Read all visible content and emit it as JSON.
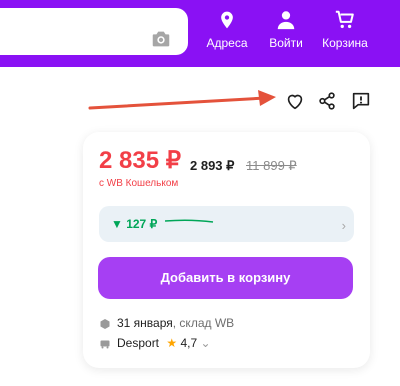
{
  "header": {
    "bg_color": "#8a11f4",
    "items": [
      {
        "label": "Адреса",
        "icon": "location-pin-icon"
      },
      {
        "label": "Войти",
        "icon": "user-icon"
      },
      {
        "label": "Корзина",
        "icon": "cart-icon"
      }
    ],
    "search_icon": "camera-icon"
  },
  "actions": {
    "icons": [
      "heart-icon",
      "share-icon",
      "report-icon"
    ]
  },
  "annotation": {
    "color": "#e4523b"
  },
  "product": {
    "price": "2 835 ₽",
    "price_without_wallet": "2 893 ₽",
    "old_price": "11 899 ₽",
    "wallet_text": "с WB Кошельком",
    "points": "▼ 127 ₽",
    "add_to_cart": "Добавить в корзину",
    "delivery_date": "31 января",
    "delivery_warehouse": ", склад WB",
    "seller_name": "Desport",
    "rating": "4,7"
  },
  "colors": {
    "price": "#f23f47",
    "button": "#a63ff3",
    "points": "#00a658"
  }
}
